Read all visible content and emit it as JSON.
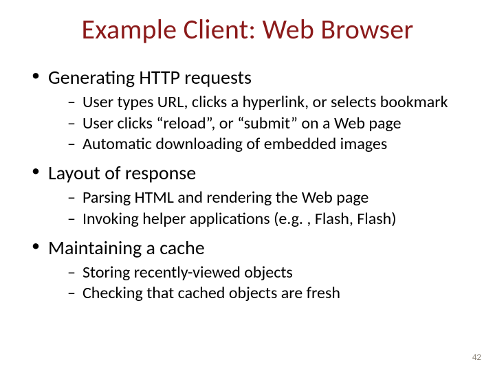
{
  "title": "Example Client: Web Browser",
  "sections": [
    {
      "heading": "Generating HTTP requests",
      "items": [
        "User types URL, clicks a hyperlink, or selects bookmark",
        "User clicks “reload”, or “submit” on a Web page",
        "Automatic downloading of embedded images"
      ]
    },
    {
      "heading": "Layout of response",
      "items": [
        "Parsing HTML and rendering the Web page",
        "Invoking helper applications (e.g. , Flash, Flash)"
      ]
    },
    {
      "heading": "Maintaining a cache",
      "items": [
        "Storing recently-viewed objects",
        "Checking that cached objects are fresh"
      ]
    }
  ],
  "slideNumber": "42"
}
